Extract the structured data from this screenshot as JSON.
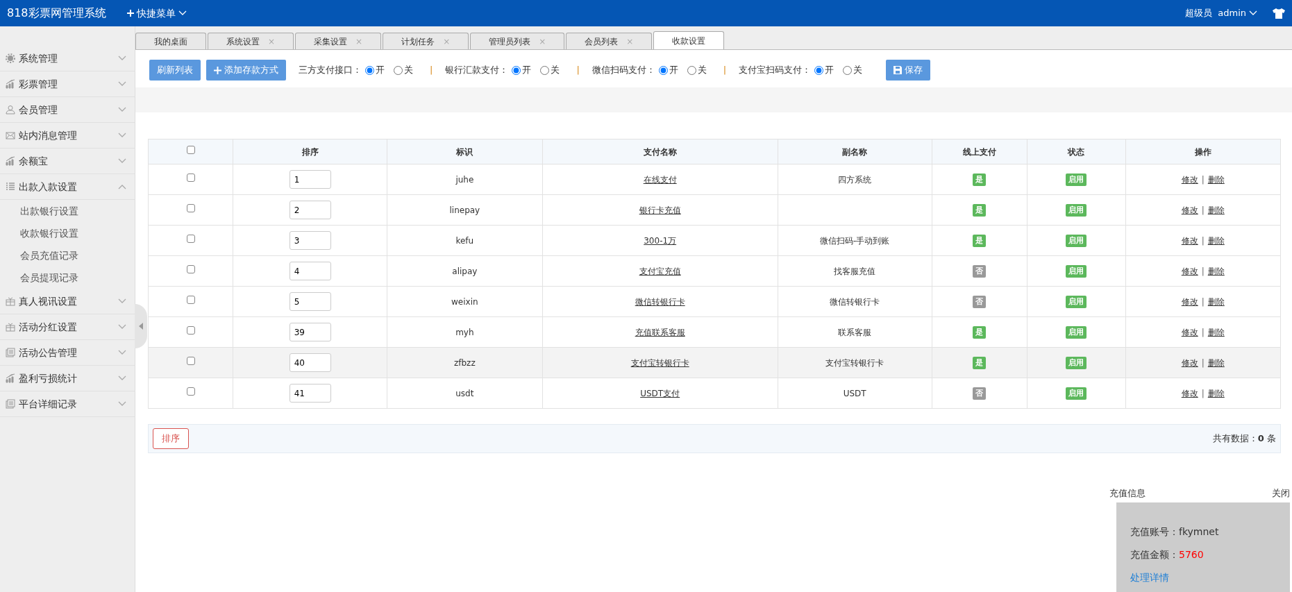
{
  "header": {
    "brand": "818彩票网管理系统",
    "quick_menu": "快捷菜单",
    "role": "超级员",
    "user": "admin"
  },
  "sidebar": {
    "items": [
      {
        "label": "系统管理",
        "expanded": false
      },
      {
        "label": "彩票管理",
        "expanded": false
      },
      {
        "label": "会员管理",
        "expanded": false
      },
      {
        "label": "站内消息管理",
        "expanded": false
      },
      {
        "label": "余额宝",
        "expanded": false
      },
      {
        "label": "出款入款设置",
        "expanded": true,
        "children": [
          {
            "label": "出款银行设置"
          },
          {
            "label": "收款银行设置"
          },
          {
            "label": "会员充值记录"
          },
          {
            "label": "会员提现记录"
          }
        ]
      },
      {
        "label": "真人视讯设置",
        "expanded": false
      },
      {
        "label": "活动分红设置",
        "expanded": false
      },
      {
        "label": "活动公告管理",
        "expanded": false
      },
      {
        "label": "盈利亏损统计",
        "expanded": false
      },
      {
        "label": "平台详细记录",
        "expanded": false
      }
    ]
  },
  "tabs": [
    {
      "label": "我的桌面",
      "selected": false
    },
    {
      "label": "系统设置",
      "selected": false,
      "close": "×"
    },
    {
      "label": "采集设置",
      "selected": false,
      "close": "×"
    },
    {
      "label": "计划任务",
      "selected": false,
      "close": "×"
    },
    {
      "label": "管理员列表",
      "selected": false,
      "close": "×"
    },
    {
      "label": "会员列表",
      "selected": false,
      "close": "×"
    },
    {
      "label": "收款设置",
      "selected": true
    }
  ],
  "toolbar": {
    "refresh": "刷新列表",
    "add": "添加存款方式",
    "separator": "|",
    "save": "保存",
    "switches": [
      {
        "label": "三方支付接口：",
        "options": [
          {
            "label": "开",
            "selected": true
          },
          {
            "label": "关",
            "selected": false
          }
        ]
      },
      {
        "label": "银行汇款支付：",
        "options": [
          {
            "label": "开",
            "selected": true
          },
          {
            "label": "关",
            "selected": false
          }
        ]
      },
      {
        "label": "微信扫码支付：",
        "options": [
          {
            "label": "开",
            "selected": true
          },
          {
            "label": "关",
            "selected": false
          }
        ]
      },
      {
        "label": "支付宝扫码支付：",
        "options": [
          {
            "label": "开",
            "selected": true
          },
          {
            "label": "关",
            "selected": false
          }
        ]
      }
    ]
  },
  "table": {
    "header_checked": false,
    "columns": [
      "排序",
      "标识",
      "支付名称",
      "副名称",
      "线上支付",
      "状态",
      "操作"
    ],
    "rows": [
      {
        "checked": false,
        "hovered": false,
        "order": "1",
        "code": "juhe",
        "name": "在线支付",
        "alias": "四方系统",
        "online": {
          "label": "是",
          "on": true
        },
        "status": {
          "label": "启用",
          "on": true
        },
        "edit": "修改",
        "sep": "|",
        "delete": "删除"
      },
      {
        "checked": false,
        "hovered": false,
        "order": "2",
        "code": "linepay",
        "name": "银行卡充值",
        "online": {
          "label": "是",
          "on": true
        },
        "status": {
          "label": "启用",
          "on": true
        },
        "edit": "修改",
        "sep": "|",
        "delete": "删除"
      },
      {
        "checked": false,
        "hovered": false,
        "order": "3",
        "code": "kefu",
        "name": "300-1万",
        "alias": "微信扫码-手动到账",
        "online": {
          "label": "是",
          "on": true
        },
        "status": {
          "label": "启用",
          "on": true
        },
        "edit": "修改",
        "sep": "|",
        "delete": "删除"
      },
      {
        "checked": false,
        "hovered": false,
        "order": "4",
        "code": "alipay",
        "name": "支付宝充值",
        "alias": "找客服充值",
        "online": {
          "label": "否",
          "on": false
        },
        "status": {
          "label": "启用",
          "on": true
        },
        "edit": "修改",
        "sep": "|",
        "delete": "删除"
      },
      {
        "checked": false,
        "hovered": false,
        "order": "5",
        "code": "weixin",
        "name": "微信转银行卡",
        "alias": "微信转银行卡",
        "online": {
          "label": "否",
          "on": false
        },
        "status": {
          "label": "启用",
          "on": true
        },
        "edit": "修改",
        "sep": "|",
        "delete": "删除"
      },
      {
        "checked": false,
        "hovered": false,
        "order": "39",
        "code": "myh",
        "name": "充值联系客服",
        "alias": "联系客服",
        "online": {
          "label": "是",
          "on": true
        },
        "status": {
          "label": "启用",
          "on": true
        },
        "edit": "修改",
        "sep": "|",
        "delete": "删除"
      },
      {
        "checked": false,
        "hovered": true,
        "order": "40",
        "code": "zfbzz",
        "name": "支付宝转银行卡",
        "alias": "支付宝转银行卡",
        "online": {
          "label": "是",
          "on": true
        },
        "status": {
          "label": "启用",
          "on": true
        },
        "edit": "修改",
        "sep": "|",
        "delete": "删除"
      },
      {
        "checked": false,
        "hovered": false,
        "order": "41",
        "code": "usdt",
        "name": "USDT支付",
        "alias": "USDT",
        "online": {
          "label": "否",
          "on": false
        },
        "status": {
          "label": "启用",
          "on": true
        },
        "edit": "修改",
        "sep": "|",
        "delete": "删除"
      }
    ]
  },
  "footer": {
    "sort_button": "排序",
    "total": "共有数据：**0** 条"
  },
  "popup": {
    "title": "充值信息",
    "close": "关闭",
    "account": "充值账号：fkymnet",
    "amount_label": "充值金额：",
    "amount": "5760",
    "link": "处理详情"
  }
}
